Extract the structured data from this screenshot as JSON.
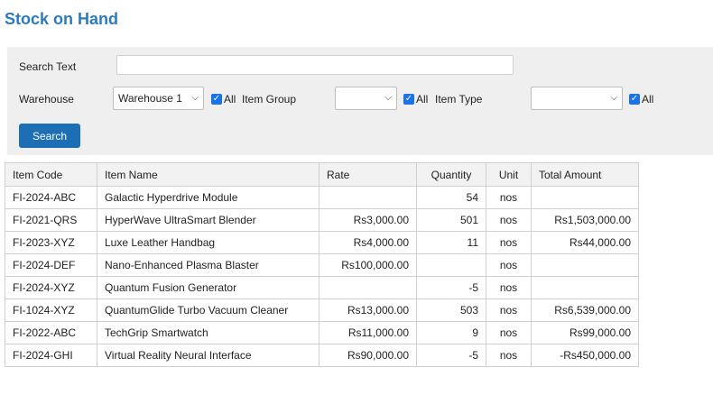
{
  "page": {
    "title": "Stock on Hand"
  },
  "filters": {
    "search_text_label": "Search Text",
    "search_text_value": "",
    "warehouse_label": "Warehouse",
    "warehouse_selected": "Warehouse 1",
    "warehouse_all_label": "All",
    "item_group_label": "Item Group",
    "item_group_selected": "",
    "item_group_all_label": "All",
    "item_type_label": "Item Type",
    "item_type_selected": "",
    "item_type_all_label": "All",
    "search_button_label": "Search",
    "checkboxes_checked": true
  },
  "table": {
    "columns": [
      "Item Code",
      "Item Name",
      "Rate",
      "Quantity",
      "Unit",
      "Total Amount"
    ],
    "rows": [
      [
        "FI-2024-ABC",
        "Galactic Hyperdrive Module",
        "",
        "54",
        "nos",
        ""
      ],
      [
        "FI-2021-QRS",
        "HyperWave UltraSmart Blender",
        "Rs3,000.00",
        "501",
        "nos",
        "Rs1,503,000.00"
      ],
      [
        "FI-2023-XYZ",
        "Luxe Leather Handbag",
        "Rs4,000.00",
        "11",
        "nos",
        "Rs44,000.00"
      ],
      [
        "FI-2024-DEF",
        "Nano-Enhanced Plasma Blaster",
        "Rs100,000.00",
        "",
        "nos",
        ""
      ],
      [
        "FI-2024-XYZ",
        "Quantum Fusion Generator",
        "",
        "-5",
        "nos",
        ""
      ],
      [
        "FI-1024-XYZ",
        "QuantumGlide Turbo Vacuum Cleaner",
        "Rs13,000.00",
        "503",
        "nos",
        "Rs6,539,000.00"
      ],
      [
        "FI-2022-ABC",
        "TechGrip Smartwatch",
        "Rs11,000.00",
        "9",
        "nos",
        "Rs99,000.00"
      ],
      [
        "FI-2024-GHI",
        "Virtual Reality Neural Interface",
        "Rs90,000.00",
        "-5",
        "nos",
        "-Rs450,000.00"
      ]
    ]
  },
  "colors": {
    "title": "#2a7bbf",
    "button": "#1c6fb5",
    "checkbox": "#1a73e8",
    "panel": "#efefef"
  }
}
